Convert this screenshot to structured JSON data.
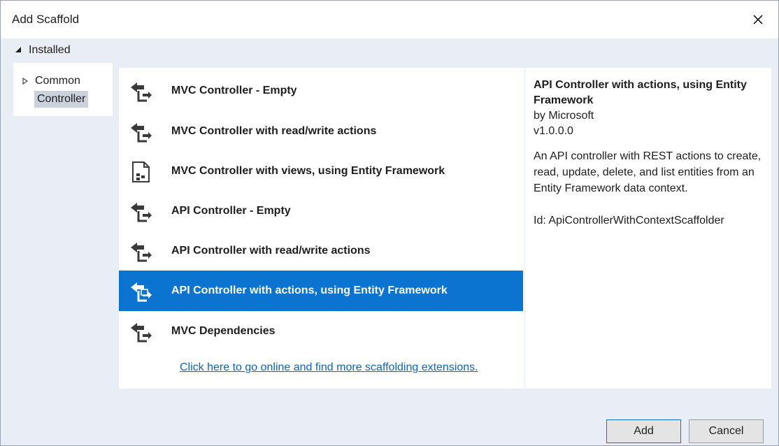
{
  "window": {
    "title": "Add Scaffold"
  },
  "installed": {
    "label": "Installed"
  },
  "tree": {
    "common_label": "Common",
    "controller_label": "Controller"
  },
  "items": [
    {
      "label": "MVC Controller - Empty",
      "icon": "controller-icon"
    },
    {
      "label": "MVC Controller with read/write actions",
      "icon": "controller-icon"
    },
    {
      "label": "MVC Controller with views, using Entity Framework",
      "icon": "views-icon"
    },
    {
      "label": "API Controller - Empty",
      "icon": "controller-icon"
    },
    {
      "label": "API Controller with read/write actions",
      "icon": "controller-icon"
    },
    {
      "label": "API Controller with actions, using Entity Framework",
      "icon": "controller-ef-icon",
      "selected": true
    },
    {
      "label": "MVC Dependencies",
      "icon": "controller-icon"
    }
  ],
  "online_link": "Click here to go online and find more scaffolding extensions.",
  "details": {
    "title": "API Controller with actions, using Entity Framework",
    "author": "by Microsoft",
    "version": "v1.0.0.0",
    "description": "An API controller with REST actions to create, read, update, delete, and list entities from an Entity Framework data context.",
    "id": "Id: ApiControllerWithContextScaffolder"
  },
  "buttons": {
    "add": "Add",
    "cancel": "Cancel"
  },
  "colors": {
    "selection": "#0b74d1",
    "link": "#0a66c2",
    "chrome": "#e9edf5"
  }
}
